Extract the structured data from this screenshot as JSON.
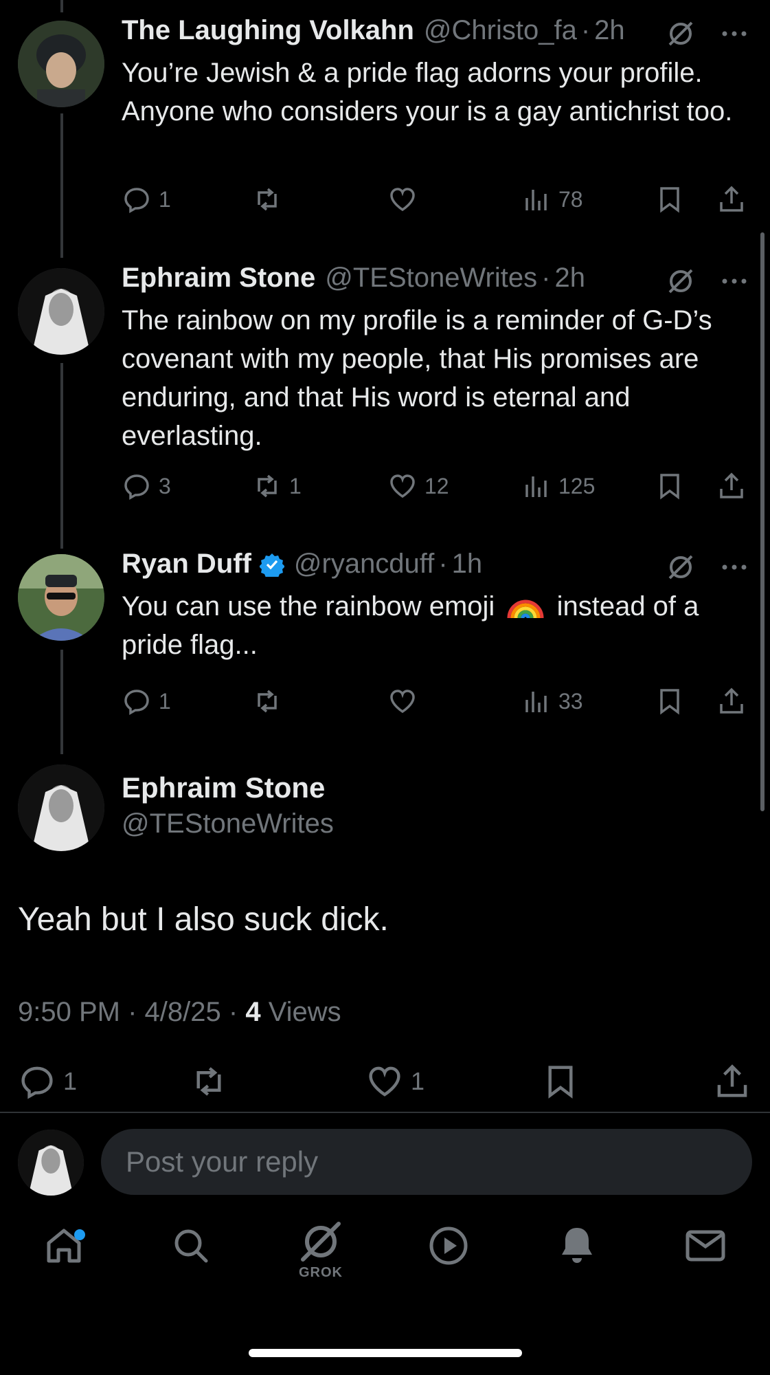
{
  "thread": [
    {
      "name": "The Laughing Volkahn",
      "handle": "@Christo_fa",
      "time": "2h",
      "text": "You’re Jewish & a pride flag adorns your profile. Anyone who considers your is a gay antichrist too.",
      "replies": "1",
      "reposts": "",
      "likes": "",
      "views": "78"
    },
    {
      "name": "Ephraim Stone",
      "handle": "@TEStoneWrites",
      "time": "2h",
      "text": "The rainbow on my profile is a reminder of G-D’s covenant with my people, that His promises are enduring, and that His word is eternal and everlasting.",
      "replies": "3",
      "reposts": "1",
      "likes": "12",
      "views": "125"
    },
    {
      "name": "Ryan Duff",
      "handle": "@ryancduff",
      "time": "1h",
      "text_before": "You can use the rainbow emoji",
      "text_after": "instead of a pride flag...",
      "replies": "1",
      "reposts": "",
      "likes": "",
      "views": "33"
    }
  ],
  "main_post": {
    "name": "Ephraim Stone",
    "handle": "@TEStoneWrites",
    "text": "Yeah but I also suck dick.",
    "time": "9:50 PM",
    "date": "4/8/25",
    "views_count": "4",
    "views_label": "Views",
    "replies": "1",
    "likes": "1"
  },
  "reply_box": {
    "placeholder": "Post your reply"
  },
  "nav": {
    "grok_label": "GROK"
  },
  "colors": {
    "accent": "#1d9bf0",
    "muted": "#71767b",
    "text": "#e7e9ea",
    "bg": "#000000"
  },
  "icons": [
    "reply-icon",
    "repost-icon",
    "like-icon",
    "views-icon",
    "bookmark-icon",
    "share-icon",
    "grok-icon",
    "more-icon",
    "home-icon",
    "search-icon",
    "video-icon",
    "bell-icon",
    "mail-icon",
    "verified-icon"
  ]
}
